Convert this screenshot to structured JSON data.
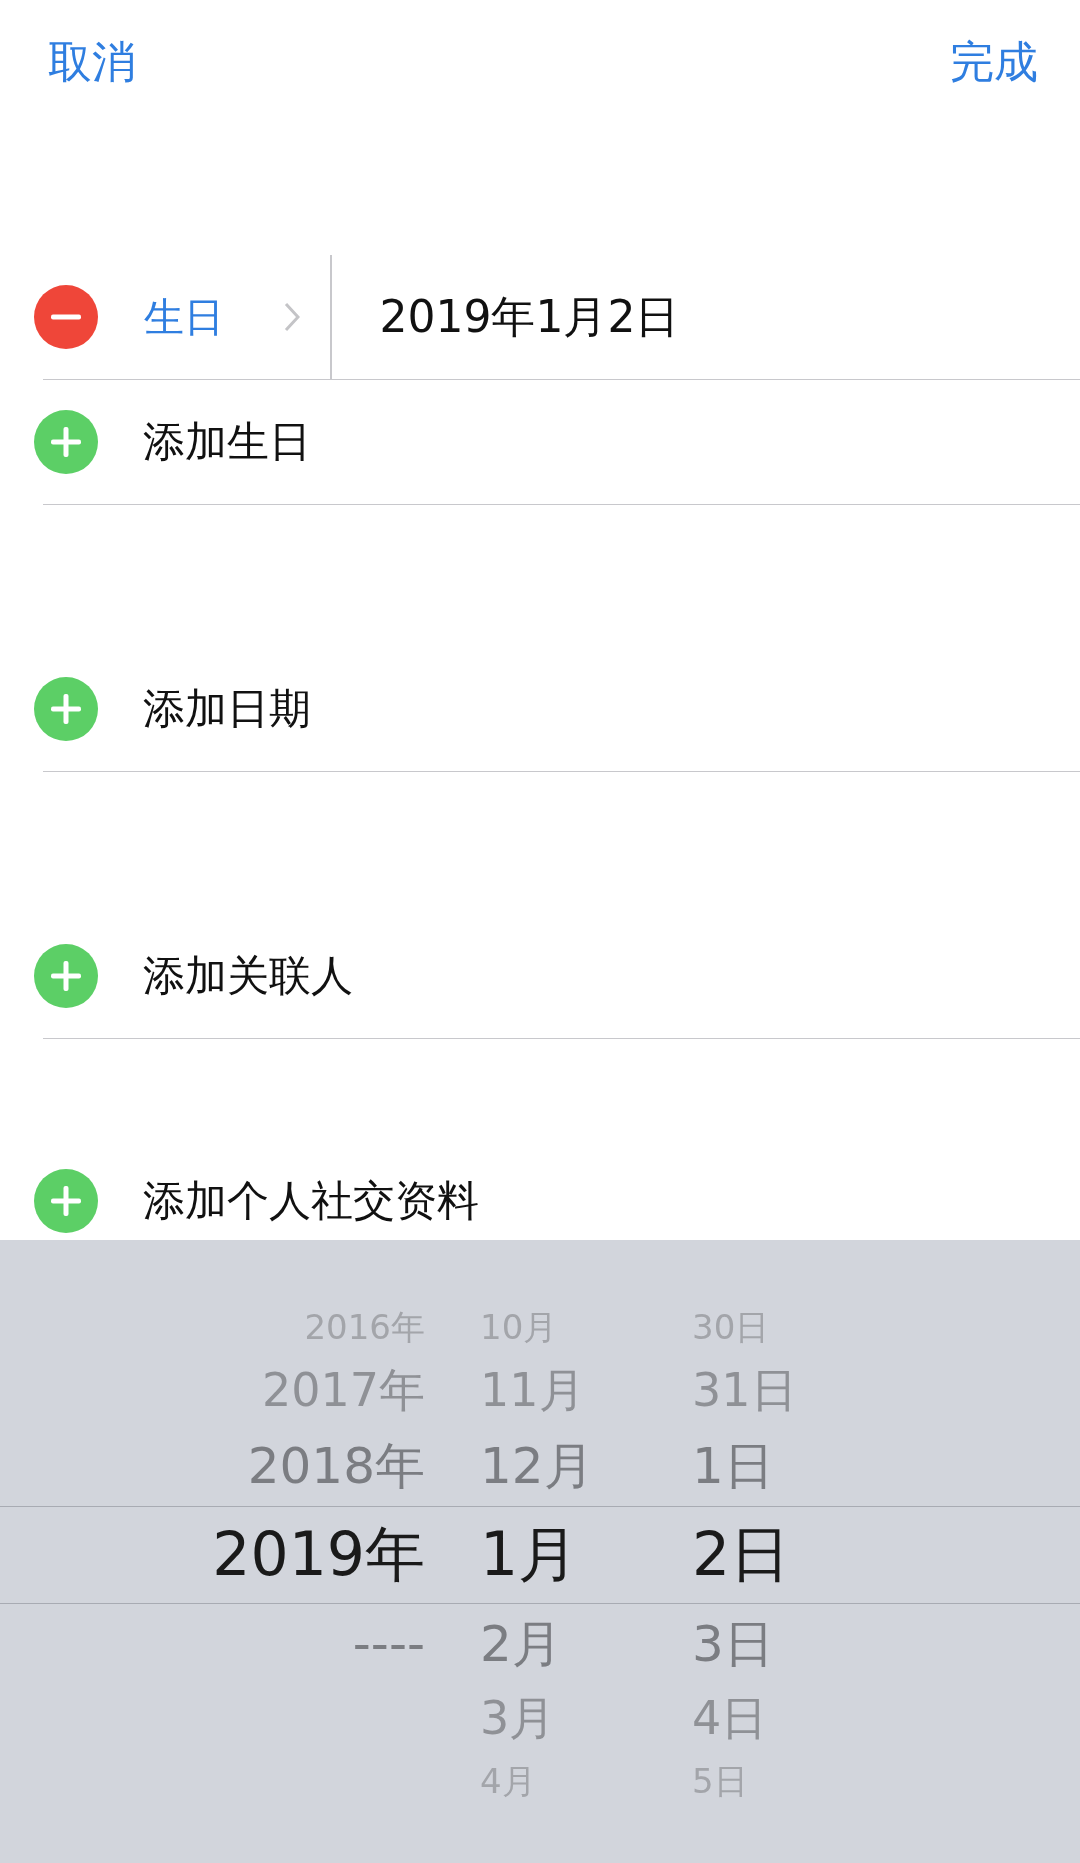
{
  "header": {
    "cancel": "取消",
    "done": "完成"
  },
  "sections": [
    {
      "rows": [
        {
          "kind": "field",
          "label": "生日",
          "value": "2019年1月2日"
        },
        {
          "kind": "add",
          "label": "添加生日"
        }
      ]
    },
    {
      "rows": [
        {
          "kind": "add",
          "label": "添加日期"
        }
      ]
    },
    {
      "rows": [
        {
          "kind": "add",
          "label": "添加关联人"
        }
      ]
    },
    {
      "rows": [
        {
          "kind": "add",
          "label": "添加个人社交资料"
        }
      ]
    }
  ],
  "picker": {
    "rows": [
      {
        "year": "2016年",
        "month": "10月",
        "day": "30日",
        "selected": false
      },
      {
        "year": "2017年",
        "month": "11月",
        "day": "31日",
        "selected": false
      },
      {
        "year": "2018年",
        "month": "12月",
        "day": "1日",
        "selected": false
      },
      {
        "year": "2019年",
        "month": "1月",
        "day": "2日",
        "selected": true
      },
      {
        "year": "----",
        "month": "2月",
        "day": "3日",
        "selected": false
      },
      {
        "month": "3月",
        "day": "4日",
        "selected": false
      },
      {
        "month": "4月",
        "day": "5日",
        "selected": false
      }
    ]
  }
}
